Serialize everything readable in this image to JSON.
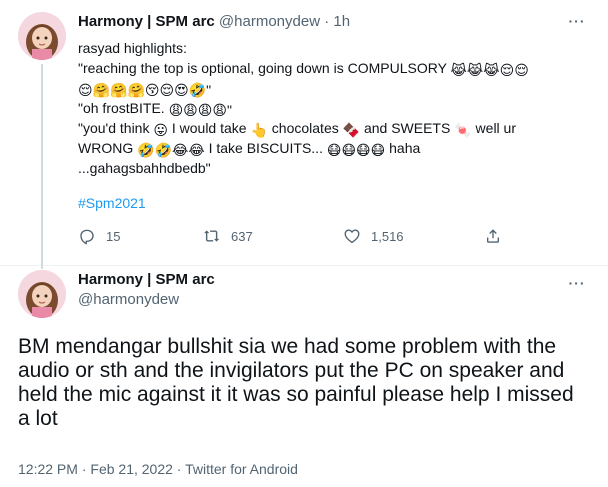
{
  "tweet1": {
    "author_name": "Harmony | SPM arc",
    "handle": "@harmonydew",
    "separator": "·",
    "age": "1h",
    "lines": [
      {
        "text": "rasyad highlights:",
        "after": ""
      },
      {
        "text": "\"reaching the top is optional, going down is COMPULSORY ",
        "after": "😹😹😹😌😌"
      },
      {
        "text": "",
        "after": "😌🤗🤗🤗😚😌😍🤣\""
      },
      {
        "text": "\"oh frostBITE. ",
        "after": "😩😩😩😩\""
      },
      {
        "text": "\"you'd think ",
        "after": "😛"
      },
      {
        "text": "WRONG ",
        "after": "🤣🤣😂😂"
      },
      {
        "text": "...gahagsbahhdbedb\"",
        "after": ""
      }
    ],
    "line5_part2": " I would take ",
    "line5_emoji2": "👆",
    "line5_part3": " chocolates ",
    "line5_emoji3": "🍫",
    "line5_part4": " and SWEETS ",
    "line5_emoji4": "🍬",
    "line5_part5": " well ur",
    "line6_part2": " I take BISCUITS... ",
    "line6_emoji2": "😷😷😷😷",
    "line6_part3": " haha",
    "hashtag": "#Spm2021",
    "replies": "15",
    "retweets": "637",
    "likes": "1,516"
  },
  "tweet2": {
    "author_name": "Harmony | SPM arc",
    "handle": "@harmonydew",
    "text": "BM mendangar bullshit sia we had some problem with the audio or sth and the invigilators put the PC on speaker and held the mic against it it was so painful please help I missed a lot",
    "time": "12:22 PM",
    "date": "Feb 21, 2022",
    "source": "Twitter for Android",
    "separator": "·"
  },
  "colors": {
    "accent": "#1d9bf0",
    "text": "#0f1419",
    "muted": "#536471"
  },
  "icons": [
    "more-icon",
    "reply-icon",
    "retweet-icon",
    "like-icon",
    "share-icon"
  ]
}
